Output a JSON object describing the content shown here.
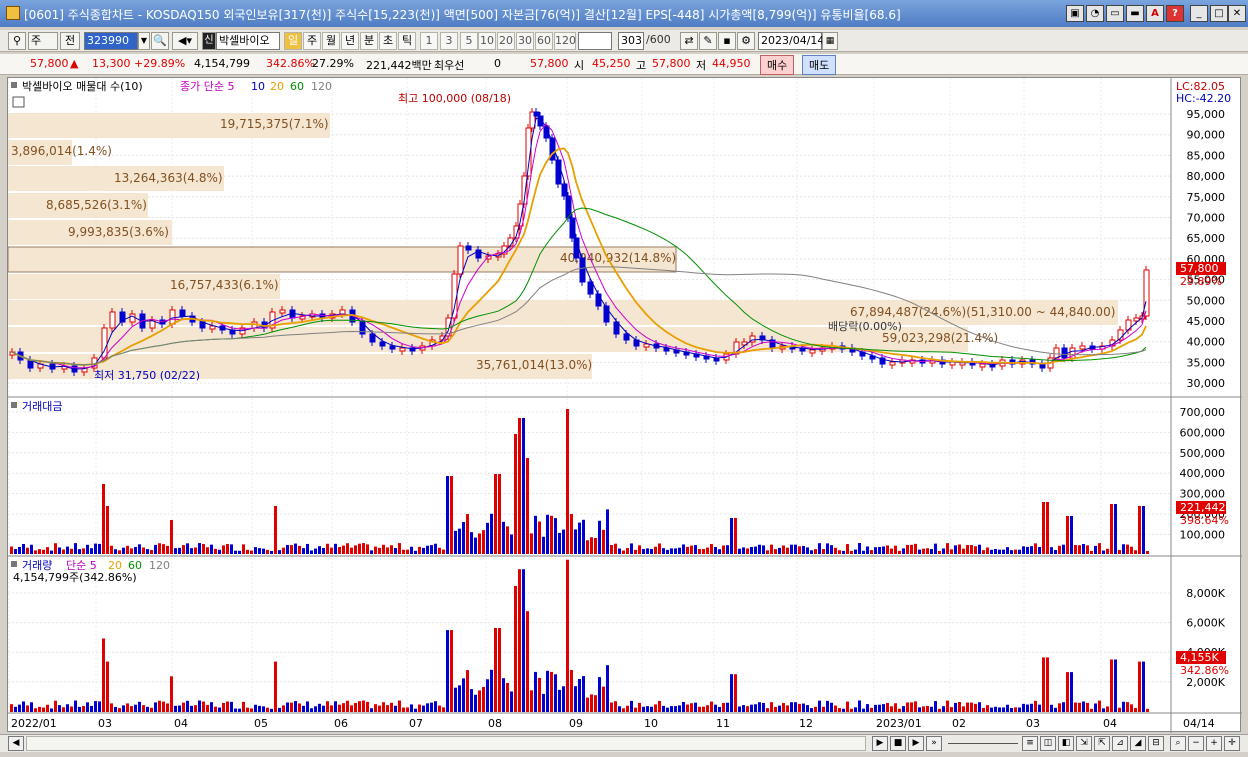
{
  "window": {
    "title": "[0601] 주식종합차트 - KOSDAQ150 외국인보유[317(천)] 주식수[15,223(천)] 액면[500] 자본금[76(억)] 결산[12월] EPS[-448] 시가총액[8,799(억)] 유통비율[68.6]",
    "buttons": [
      "▣",
      "◔",
      "▭",
      "▬",
      "A",
      "?",
      "_",
      "□",
      "✕"
    ]
  },
  "toolbar": {
    "type_select": "주",
    "prev_label": "전",
    "code": "323990",
    "stock_badge": "신",
    "stock_name": "박셀바이오",
    "periods": [
      "일",
      "주",
      "월",
      "년",
      "분",
      "초",
      "틱"
    ],
    "intervals": [
      "1",
      "3",
      "5",
      "10",
      "20",
      "30",
      "60",
      "120"
    ],
    "count": "303",
    "count_max": "/600",
    "date": "2023/04/14"
  },
  "quote": {
    "price": "57,800",
    "arrow": "▲",
    "change": "13,300",
    "change_pct": "+29.89%",
    "volume": "4,154,799",
    "volume_pct": "342.86%",
    "turnover_pct": "27.29%",
    "amount": "221,442백만",
    "best_bid_label": "최우선",
    "best_bid_qty": "0",
    "best_price": "57,800",
    "open_label": "시",
    "open": "45,250",
    "high_label": "고",
    "high": "57,800",
    "low_label": "저",
    "low": "44,950",
    "buy_label": "매수",
    "sell_label": "매도"
  },
  "price_panel": {
    "title": "박셀바이오 매물대 수(10)",
    "ma_label": "종가 단순 5",
    "ma_periods": [
      "10",
      "20",
      "60",
      "120"
    ],
    "lc": "LC:82.05",
    "hc": "HC:-42.20",
    "high_note": "최고 100,000 (08/18)",
    "low_note": "최저 31,750 (02/22)",
    "dividend_note": "배당락(0.00%)",
    "current_price_tag": "57,800",
    "current_pct_tag": "29.89%",
    "y_ticks": [
      "95,000",
      "90,000",
      "85,000",
      "80,000",
      "75,000",
      "70,000",
      "65,000",
      "60,000",
      "55,000",
      "50,000",
      "45,000",
      "40,000",
      "35,000",
      "30,000"
    ],
    "volume_profile": [
      {
        "label": "19,715,375(7.1%)"
      },
      {
        "label": "3,896,014(1.4%)"
      },
      {
        "label": "13,264,363(4.8%)"
      },
      {
        "label": "8,685,526(3.1%)"
      },
      {
        "label": "9,993,835(3.6%)"
      },
      {
        "label": "40,940,932(14.8%)"
      },
      {
        "label": "16,757,433(6.1%)"
      },
      {
        "label": "67,894,487(24.6%)(51,310.00 ~ 44,840.00)"
      },
      {
        "label": "59,023,298(21.4%)"
      },
      {
        "label": "35,761,014(13.0%)"
      }
    ]
  },
  "amount_panel": {
    "title": "거래대금",
    "y_ticks": [
      "700,000",
      "600,000",
      "500,000",
      "400,000",
      "300,000",
      "200,000",
      "100,000"
    ],
    "current_tag": "221,442",
    "current_pct": "398.64%"
  },
  "volume_panel": {
    "title": "거래량",
    "ma_label": "단순 5",
    "ma_periods": [
      "20",
      "60",
      "120"
    ],
    "current_line": "4,154,799주(342.86%)",
    "y_ticks": [
      "8,000K",
      "6,000K",
      "4,000K",
      "2,000K"
    ],
    "current_tag": "4,155K",
    "current_pct": "342.86%"
  },
  "x_axis": {
    "labels": [
      "2022/01",
      "03",
      "04",
      "05",
      "06",
      "07",
      "08",
      "09",
      "10",
      "11",
      "12",
      "2023/01",
      "02",
      "03",
      "04"
    ],
    "last_date": "04/14"
  },
  "colors": {
    "up": "#e00000",
    "down": "#0000d0",
    "ma5": "#0000c0",
    "ma10": "#d000d0",
    "ma20": "#e8a000",
    "ma60": "#009000",
    "ma120": "#808080",
    "profile": "#f5e6d2"
  }
}
